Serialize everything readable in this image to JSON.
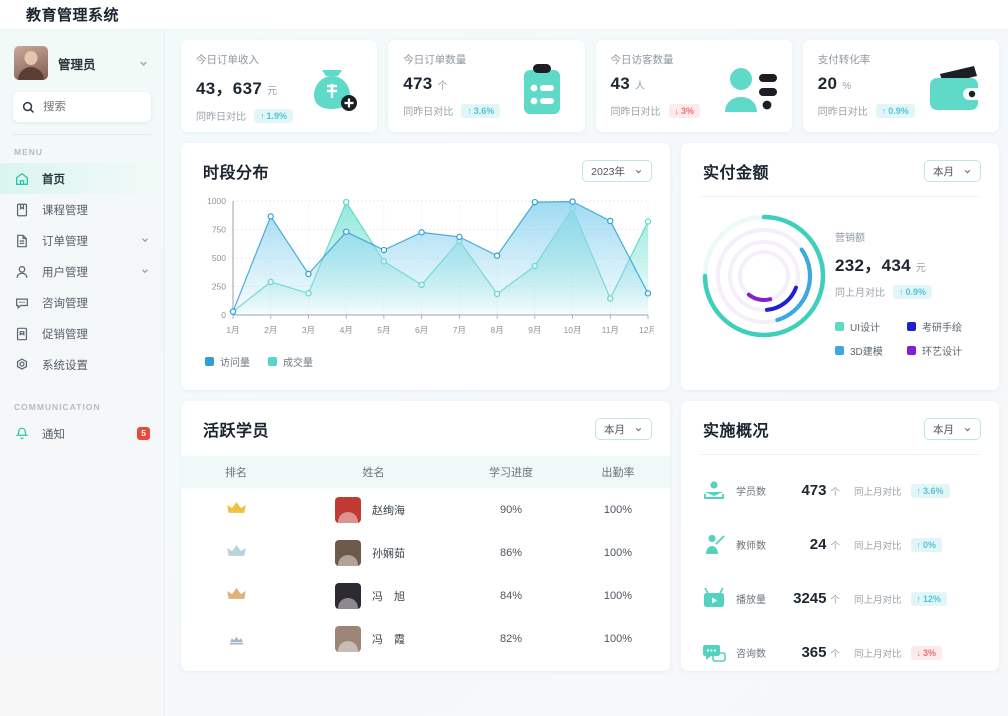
{
  "app": {
    "title": "教育管理系统"
  },
  "sidebar": {
    "user": {
      "name": "管理员",
      "chevron_icon": "chevron-down-icon",
      "avatar_icon": "avatar"
    },
    "search": {
      "placeholder": "搜索",
      "icon": "search-icon"
    },
    "menu_label": "MENU",
    "items": [
      {
        "label": "首页",
        "icon": "home-icon",
        "active": true,
        "expandable": false
      },
      {
        "label": "课程管理",
        "icon": "book-icon",
        "active": false,
        "expandable": false
      },
      {
        "label": "订单管理",
        "icon": "document-icon",
        "active": false,
        "expandable": true
      },
      {
        "label": "用户管理",
        "icon": "user-icon",
        "active": false,
        "expandable": true
      },
      {
        "label": "咨询管理",
        "icon": "chat-icon",
        "active": false,
        "expandable": false
      },
      {
        "label": "促销管理",
        "icon": "tag-icon",
        "active": false,
        "expandable": false
      },
      {
        "label": "系统设置",
        "icon": "gear-icon",
        "active": false,
        "expandable": false
      }
    ],
    "communication_label": "COMMUNICATION",
    "notification": {
      "label": "通知",
      "icon": "bell-icon",
      "badge": "5"
    }
  },
  "stats": [
    {
      "label": "今日订单收入",
      "value": "43，637",
      "unit": "元",
      "compare_label": "同昨日对比",
      "delta": "1.9%",
      "direction": "up",
      "icon": "money-bag-icon"
    },
    {
      "label": "今日订单数量",
      "value": "473",
      "unit": "个",
      "compare_label": "同昨日对比",
      "delta": "3.6%",
      "direction": "up",
      "icon": "clipboard-icon"
    },
    {
      "label": "今日访客数量",
      "value": "43",
      "unit": "人",
      "compare_label": "同昨日对比",
      "delta": "3%",
      "direction": "down",
      "icon": "visitor-icon"
    },
    {
      "label": "支付转化率",
      "value": "20",
      "unit": "%",
      "compare_label": "同昨日对比",
      "delta": "0.9%",
      "direction": "up",
      "icon": "wallet-icon"
    }
  ],
  "line_panel": {
    "title": "时段分布",
    "selector": "2023年",
    "selector_icon": "chevron-down-icon"
  },
  "donut_panel": {
    "title": "实付金额",
    "selector": "本月",
    "selector_icon": "chevron-down-icon",
    "marketing_label": "营销额",
    "marketing_value": "232，434",
    "marketing_unit": "元",
    "compare_label": "同上月对比",
    "delta": "0.9%",
    "direction": "up"
  },
  "students_panel": {
    "title": "活跃学员",
    "selector": "本月",
    "selector_icon": "chevron-down-icon",
    "columns": [
      "排名",
      "姓名",
      "学习进度",
      "出勤率"
    ],
    "rows": [
      {
        "rank_icon": "gold-crown-icon",
        "name": "赵绚海",
        "progress": "90%",
        "attendance": "100%",
        "avatar_color": "#c03a33"
      },
      {
        "rank_icon": "silver-crown-icon",
        "name": "孙娴茹",
        "progress": "86%",
        "attendance": "100%",
        "avatar_color": "#6d5a4a"
      },
      {
        "rank_icon": "bronze-crown-icon",
        "name": "冯　旭",
        "progress": "84%",
        "attendance": "100%",
        "avatar_color": "#2e2a33"
      },
      {
        "rank_icon": "medal-icon",
        "name": "冯　霞",
        "progress": "82%",
        "attendance": "100%",
        "avatar_color": "#9c8577"
      }
    ]
  },
  "overview_panel": {
    "title": "实施概况",
    "selector": "本月",
    "selector_icon": "chevron-down-icon",
    "rows": [
      {
        "label": "学员数",
        "value": "473",
        "unit": "个",
        "compare_label": "同上月对比",
        "delta": "3.6%",
        "direction": "up",
        "icon": "student-icon"
      },
      {
        "label": "教师数",
        "value": "24",
        "unit": "个",
        "compare_label": "同上月对比",
        "delta": "0%",
        "direction": "up",
        "icon": "teacher-icon"
      },
      {
        "label": "播放量",
        "value": "3245",
        "unit": "个",
        "compare_label": "同上月对比",
        "delta": "12%",
        "direction": "up",
        "icon": "video-icon"
      },
      {
        "label": "咨询数",
        "value": "365",
        "unit": "个",
        "compare_label": "同上月对比",
        "delta": "3%",
        "direction": "down",
        "icon": "comment-icon"
      }
    ]
  },
  "colors": {
    "accent_teal": "#3fd0bd",
    "line_blue": "#2f9fd4",
    "line_teal": "#56d6c6",
    "up_pill_bg": "#e2f6f9",
    "up_pill_fg": "#4fc4d8",
    "down_pill_bg": "#fdeaea",
    "down_pill_fg": "#f07070",
    "badge_red": "#f0453a"
  },
  "chart_data": [
    {
      "type": "line",
      "title": "时段分布",
      "xlabel": "",
      "ylabel": "",
      "categories": [
        "1月",
        "2月",
        "3月",
        "4月",
        "5月",
        "6月",
        "7月",
        "8月",
        "9月",
        "10月",
        "11月",
        "12月"
      ],
      "ylim": [
        0,
        1000
      ],
      "yticks": [
        0,
        250,
        500,
        750,
        1000
      ],
      "grid": true,
      "legend_position": "bottom-left",
      "series": [
        {
          "name": "访问量",
          "color": "#2f9fd4",
          "values": [
            30,
            865,
            360,
            730,
            570,
            725,
            685,
            520,
            990,
            995,
            825,
            190
          ]
        },
        {
          "name": "成交量",
          "color": "#56d6c6",
          "values": [
            30,
            290,
            190,
            990,
            470,
            265,
            650,
            185,
            430,
            935,
            145,
            820
          ]
        }
      ]
    },
    {
      "type": "pie",
      "title": "实付金额",
      "subtitle": "营销额 232，434 元",
      "legend_position": "right",
      "categories": [
        "UI设计",
        "3D建模",
        "考研手绘",
        "环艺设计"
      ],
      "values": [
        75,
        30,
        18,
        15
      ],
      "colors": [
        "#3fd0bd",
        "#3ea8e0",
        "#2020d0",
        "#8020d0"
      ]
    }
  ]
}
